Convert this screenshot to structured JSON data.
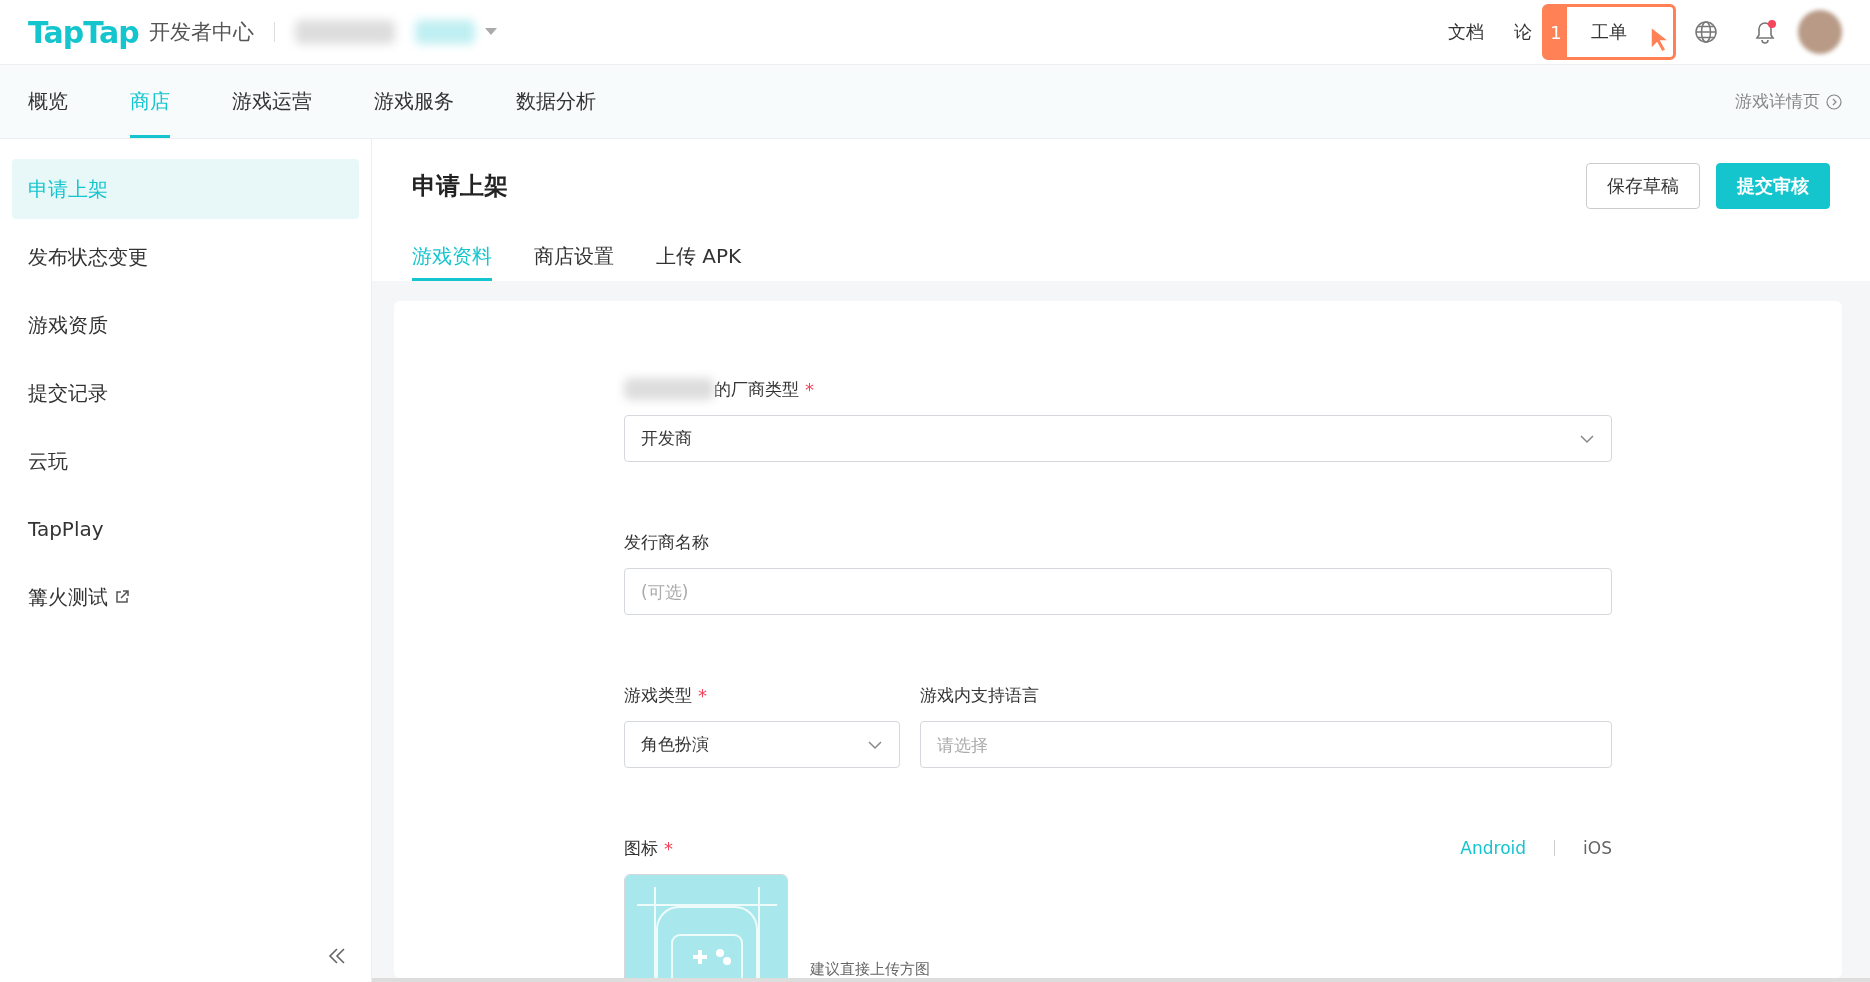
{
  "header": {
    "logo": "TapTap",
    "product": "开发者中心",
    "links": [
      {
        "label": "文档"
      },
      {
        "label": "论"
      }
    ],
    "highlight": {
      "step": "1",
      "label": "工单"
    },
    "notification_unread": true
  },
  "nav": {
    "tabs": [
      {
        "label": "概览",
        "selected": false
      },
      {
        "label": "商店",
        "selected": true
      },
      {
        "label": "游戏运营",
        "selected": false
      },
      {
        "label": "游戏服务",
        "selected": false
      },
      {
        "label": "数据分析",
        "selected": false
      }
    ],
    "detail_link": "游戏详情页"
  },
  "sidebar": {
    "items": [
      {
        "label": "申请上架",
        "selected": true,
        "external": false
      },
      {
        "label": "发布状态变更",
        "selected": false,
        "external": false
      },
      {
        "label": "游戏资质",
        "selected": false,
        "external": false
      },
      {
        "label": "提交记录",
        "selected": false,
        "external": false
      },
      {
        "label": "云玩",
        "selected": false,
        "external": false
      },
      {
        "label": "TapPlay",
        "selected": false,
        "external": false
      },
      {
        "label": "篝火测试",
        "selected": false,
        "external": true
      }
    ]
  },
  "page": {
    "title": "申请上架",
    "buttons": [
      {
        "label": "保存草稿",
        "kind": "secondary"
      },
      {
        "label": "提交审核",
        "kind": "primary"
      }
    ],
    "tabs": [
      {
        "label": "游戏资料",
        "selected": true
      },
      {
        "label": "商店设置",
        "selected": false
      },
      {
        "label": "上传 APK",
        "selected": false
      }
    ]
  },
  "form": {
    "vendor_type": {
      "label": "的厂商类型",
      "required_mark": "*",
      "value": "开发商"
    },
    "publisher": {
      "label": "发行商名称",
      "placeholder": "(可选)"
    },
    "genre": {
      "label": "游戏类型",
      "required_mark": "*",
      "value": "角色扮演"
    },
    "languages": {
      "label": "游戏内支持语言",
      "placeholder": "请选择"
    },
    "icon": {
      "label": "图标",
      "required_mark": "*",
      "platforms": [
        {
          "label": "Android",
          "selected": true
        },
        {
          "label": "iOS",
          "selected": false
        }
      ],
      "hint": "建议直接上传方图"
    }
  }
}
